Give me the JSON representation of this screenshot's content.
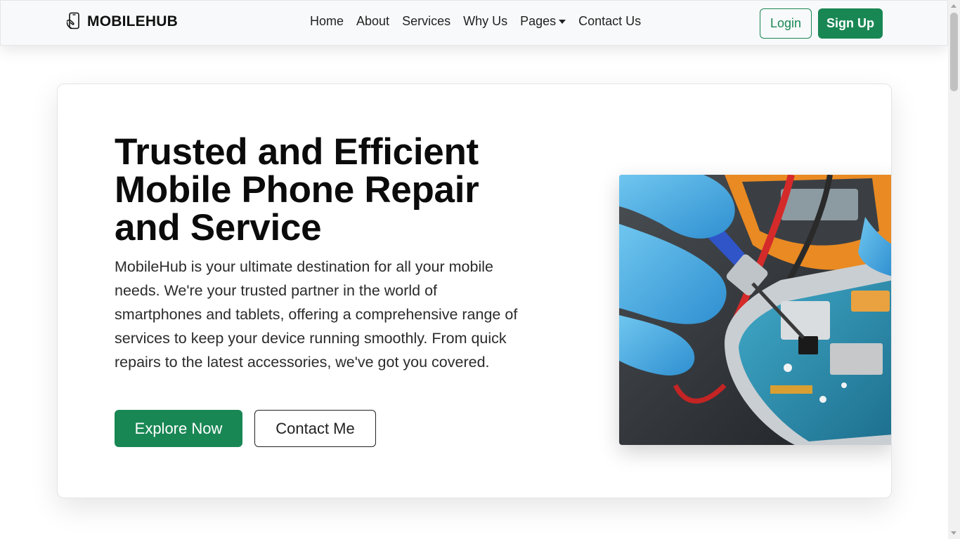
{
  "brand": {
    "name": "MOBILEHUB",
    "icon": "phone-repair-icon"
  },
  "nav": {
    "links": [
      "Home",
      "About",
      "Services",
      "Why Us",
      "Pages",
      "Contact Us"
    ]
  },
  "auth": {
    "login": "Login",
    "signup": "Sign Up"
  },
  "hero": {
    "title": "Trusted and Efficient Mobile Phone Repair and Service",
    "text": "MobileHub is your ultimate destination for all your mobile needs. We're your trusted partner in the world of smartphones and tablets, offering a comprehensive range of services to keep your device running smoothly. From quick repairs to the latest accessories, we've got you covered.",
    "primary_button": "Explore Now",
    "secondary_button": "Contact Me"
  },
  "colors": {
    "accent": "#198754",
    "navbar_bg": "#f8f9fa"
  }
}
